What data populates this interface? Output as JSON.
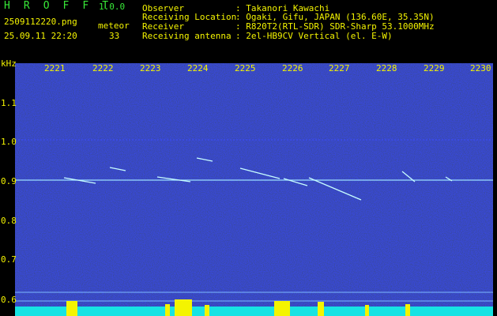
{
  "header": {
    "brand": "H R O F F T",
    "version": "1.0.0",
    "filename": "2509112220.png",
    "datetime": "25.09.11 22:20",
    "meteor_label": "meteor",
    "meteor_count": "33",
    "info": [
      {
        "key": "Observer",
        "value": ": Takanori Kawachi"
      },
      {
        "key": "Receiving Location",
        "value": ": Ogaki, Gifu, JAPAN (136.60E, 35.35N)"
      },
      {
        "key": "Receiver",
        "value": ": R820T2(RTL-SDR) SDR-Sharp 53.1000MHz"
      },
      {
        "key": "Receiving antenna",
        "value": ": 2el-HB9CV Vertical (el. E-W)"
      }
    ]
  },
  "axes": {
    "y_unit": "kHz",
    "y_ticks": [
      "1.1",
      "1.0",
      "0.9",
      "0.8",
      "0.7",
      "0.6"
    ],
    "x_ticks": [
      "2221",
      "2222",
      "2223",
      "2224",
      "2225",
      "2226",
      "2227",
      "2228",
      "2229",
      "2230"
    ]
  },
  "colors": {
    "background": "#000000",
    "text": "#f4f400",
    "brand": "#38e838",
    "noise": "#1010a0",
    "signal": "#c8ffff"
  }
}
